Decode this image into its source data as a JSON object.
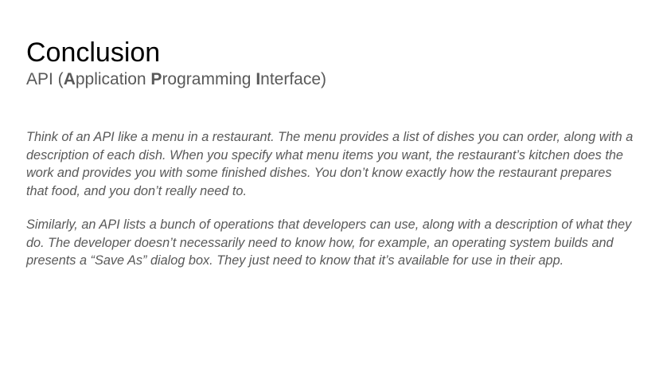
{
  "slide": {
    "title": "Conclusion",
    "subtitle": {
      "prefix": "API (",
      "a_bold": "A",
      "a_rest": "pplication ",
      "p_bold": "P",
      "p_rest": "rogramming ",
      "i_bold": "I",
      "i_rest": "nterface)"
    },
    "paragraphs": [
      {
        "lines": [
          "Think of an API like a menu in a restaurant. The menu provides a list of dishes you can order, along with a",
          "description of each dish. When you specify what menu items you want, the restaurant’s kitchen does the",
          "work and provides you with some finished dishes. You don’t know exactly how the restaurant prepares",
          "that food, and you don’t really need to."
        ]
      },
      {
        "lines": [
          "Similarly, an API lists a bunch of operations that developers can use, along with a description of what they",
          "do. The developer doesn’t necessarily need to know how, for example, an operating system builds and",
          "presents a “Save As” dialog box. They just need to know that it’s available for use in their app."
        ]
      }
    ]
  }
}
